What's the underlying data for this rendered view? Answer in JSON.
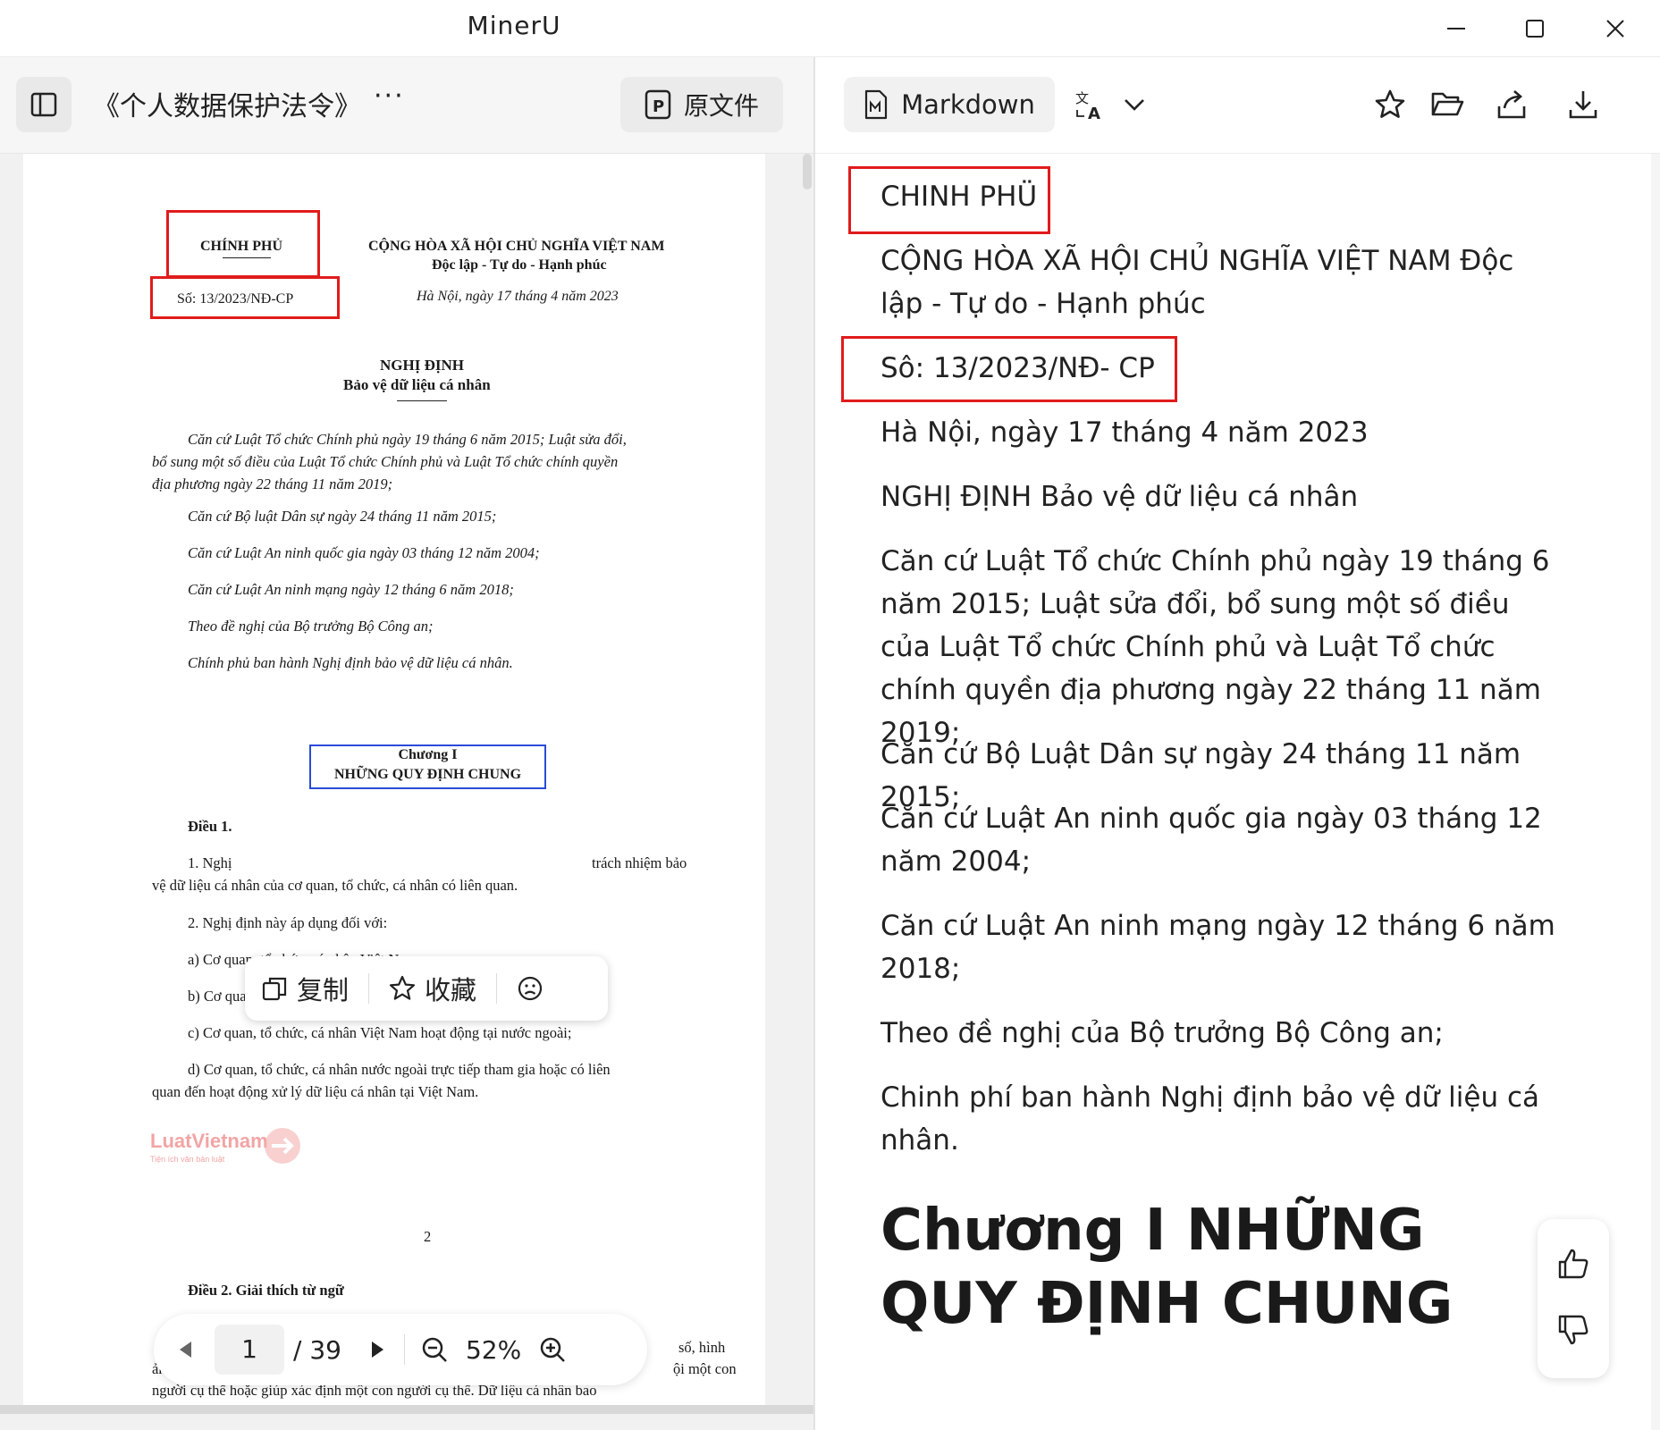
{
  "app": {
    "title": "MinerU"
  },
  "left": {
    "doc_title": "《个人数据保护法令》",
    "doc_more": "···",
    "source_button": "原文件",
    "pdf": {
      "gov": "CHÍNH PHỦ",
      "republic": "CỘNG HÒA XÃ HỘI CHỦ NGHĨA VIỆT NAM",
      "motto": "Độc lập - Tự do - Hạnh phúc",
      "number": "Số: 13/2023/NĐ-CP",
      "date": "Hà Nội, ngày 17 tháng 4 năm 2023",
      "decree": "NGHỊ ĐỊNH",
      "decree_subtitle": "Bảo vệ dữ liệu cá nhân",
      "preamble_lines": [
        "Căn cứ Luật Tổ chức Chính phủ ngày 19 tháng 6 năm 2015; Luật sửa đổi,",
        "bổ sung một số điều của Luật Tổ chức Chính phủ và Luật Tổ chức chính quyền",
        "địa phương ngày 22 tháng 11 năm 2019;"
      ],
      "basis": [
        "Căn cứ Bộ luật Dân sự ngày 24 tháng 11 năm 2015;",
        "Căn cứ Luật An ninh quốc gia ngày 03 tháng 12 năm 2004;",
        "Căn cứ Luật An ninh mạng ngày 12 tháng 6 năm 2018;",
        "Theo đề nghị của Bộ trưởng Bộ Công an;",
        "Chính phủ ban hành Nghị định bảo vệ dữ liệu cá nhân."
      ],
      "chapter": "Chương I",
      "chapter_title": "NHỮNG QUY ĐỊNH CHUNG",
      "article1": "Điều 1.",
      "a1_l1_start": "1. Nghị",
      "a1_l1_end": "trách nhiệm bảo",
      "a1_l2": "vệ dữ liệu cá nhân của cơ quan, tổ chức, cá nhân có liên quan.",
      "a1_items": [
        "2. Nghị định này áp dụng đối với:",
        "a) Cơ quan, tổ chức, cá nhân Việt Nam;",
        "b) Cơ quan, tổ chức, cá nhân nước ngoài tại Việt Nam;",
        "c) Cơ quan, tổ chức, cá nhân Việt Nam hoạt động tại nước ngoài;",
        "d) Cơ quan, tổ chức, cá nhân nước ngoài trực tiếp tham gia hoặc có liên"
      ],
      "a1_last": "quan đến hoạt động xử lý dữ liệu cá nhân tại Việt Nam.",
      "watermark": "LuatVietnam",
      "watermark_sub": "Tiện ích văn bản luật",
      "page_number": "2",
      "article2": "Điều 2. Giải thích từ ngữ",
      "tail_r1": "số, hình",
      "tail_l2": "ản",
      "tail_r2": "ội một con",
      "tail_last": "người cụ thể hoặc giúp xác định một con người cụ thể. Dữ liệu cá nhân bao"
    },
    "popup": {
      "copy": "复制",
      "favorite": "收藏"
    },
    "pager": {
      "current": "1",
      "total": "/ 39",
      "zoom": "52%"
    }
  },
  "right": {
    "markdown_button": "Markdown",
    "content": {
      "p1": "CHINH PHÜ",
      "p2": "CỘNG HÒA XÃ HỘI CHỦ NGHĨA VIỆT NAM Độc lập - Tự do - Hạnh phúc",
      "p3": "Sô: 13/2023/NĐ- CP",
      "p4": "Hà Nội, ngày 17 tháng 4 năm 2023",
      "p5": "NGHỊ ĐỊNH Bảo vệ dữ liệu cá nhân",
      "p6": "Căn cứ Luật Tổ chức Chính phủ ngày 19 tháng 6 năm 2015; Luật sửa đổi, bổ sung một số điều của Luật Tổ chức Chính phủ và Luật Tổ chức chính quyền địa phương ngày 22 tháng 11 năm 2019;",
      "p7": "Căn cứ Bộ Luật Dân sự ngày 24 tháng 11 năm 2015;",
      "p8": "Căn cứ Luật An ninh quốc gia ngày 03 tháng 12 năm 2004;",
      "p9": "Căn cứ Luật An ninh mạng ngày 12 tháng 6 năm 2018;",
      "p10": "Theo đề nghị của Bộ trưởng Bộ Công an;",
      "p11": "Chinh phí ban hành Nghị định bảo vệ dữ liệu cá nhân.",
      "h1": "Chương I NHỮNG QUY ĐỊNH CHUNG"
    }
  },
  "colors": {
    "highlight_red": "#e01b1b",
    "highlight_blue": "#2a4bd7",
    "watermark": "#e85a5a"
  },
  "icons": [
    "sidebar-toggle-icon",
    "pdf-file-icon",
    "minimize-icon",
    "maximize-icon",
    "close-icon",
    "markdown-file-icon",
    "translate-icon",
    "chevron-down-icon",
    "star-icon",
    "folder-open-icon",
    "share-icon",
    "download-icon",
    "copy-icon",
    "smiley-icon",
    "prev-page-icon",
    "next-page-icon",
    "zoom-out-icon",
    "zoom-in-icon",
    "thumbs-up-icon",
    "thumbs-down-icon"
  ]
}
